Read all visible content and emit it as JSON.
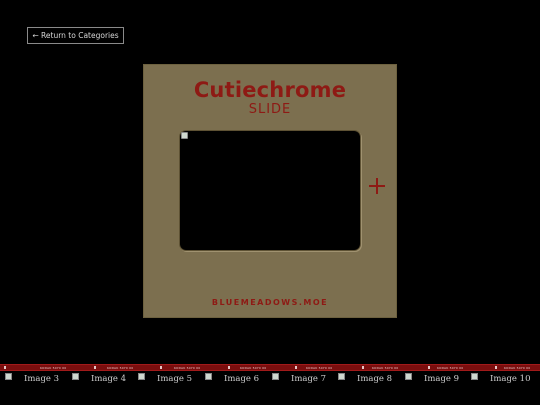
{
  "nav": {
    "back_label": "← Return to Categories"
  },
  "slide": {
    "brand_title": "Cutiechrome",
    "brand_subtitle": "SLIDE",
    "domain": "BLUEMEADOWS.MOE",
    "add_symbol": "+"
  },
  "filmstrip": {
    "marks": [
      "KODAK 5070 00",
      "KODAK 5070 00",
      "KODAK 5070 00",
      "KODAK 5070 00",
      "KODAK 5070 00",
      "KODAK 5070 00",
      "KODAK 5070 00",
      "KODAK 5070 00"
    ]
  },
  "thumbnails": [
    "Image 3",
    "Image 4",
    "Image 5",
    "Image 6",
    "Image 7",
    "Image 8",
    "Image 9",
    "Image 10"
  ],
  "colors": {
    "background": "#000000",
    "slide_mount": "#7c6f4f",
    "brand_red": "#8e1a14",
    "film_red": "#7a0e0e"
  }
}
